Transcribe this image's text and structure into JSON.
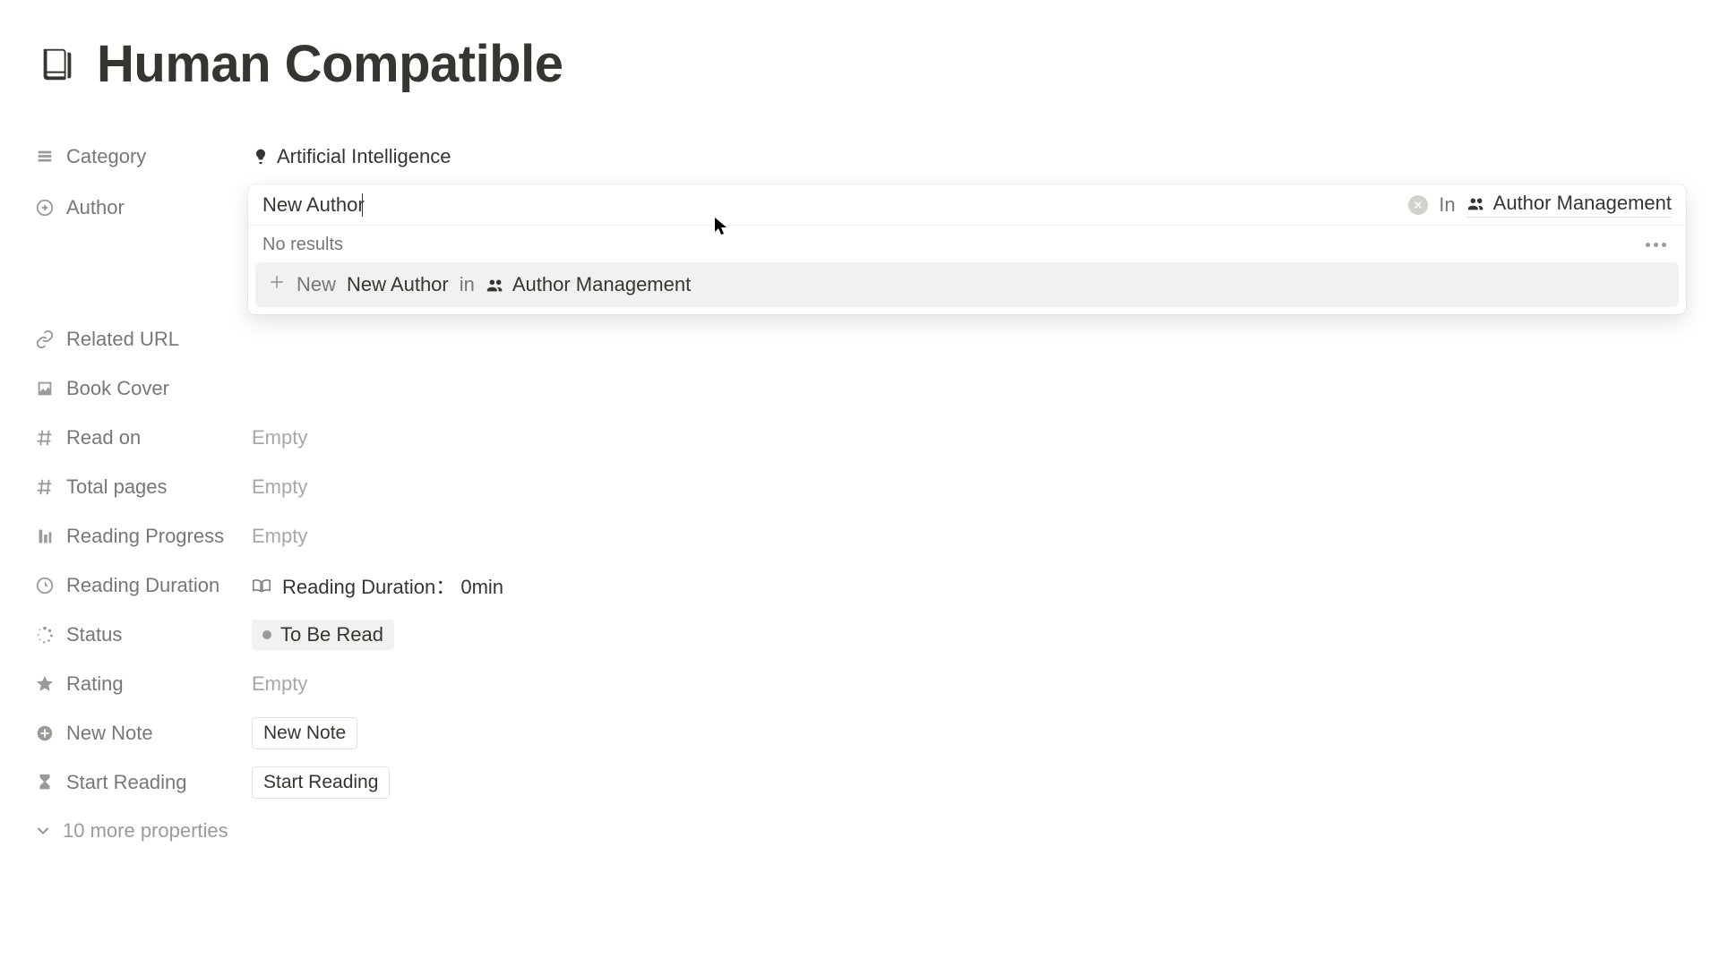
{
  "page": {
    "title": "Human Compatible"
  },
  "properties": {
    "category": {
      "label": "Category",
      "value": "Artificial Intelligence"
    },
    "author": {
      "label": "Author"
    },
    "relatedUrl": {
      "label": "Related URL",
      "value": ""
    },
    "bookCover": {
      "label": "Book Cover",
      "value": ""
    },
    "readOn": {
      "label": "Read on",
      "value": "Empty"
    },
    "totalPages": {
      "label": "Total pages",
      "value": "Empty"
    },
    "readingProgress": {
      "label": "Reading Progress",
      "value": "Empty"
    },
    "readingDuration": {
      "label": "Reading Duration",
      "prefix": "Reading Duration：",
      "value": "0min"
    },
    "status": {
      "label": "Status",
      "value": "To Be Read"
    },
    "rating": {
      "label": "Rating",
      "value": "Empty"
    },
    "newNote": {
      "label": "New Note",
      "button": "New Note"
    },
    "startReading": {
      "label": "Start Reading",
      "button": "Start Reading"
    }
  },
  "relationPopover": {
    "inputValue": "New Author",
    "inLabel": "In",
    "targetDb": "Author Management",
    "noResults": "No results",
    "createPrefix": "New",
    "createValue": "New Author",
    "createIn": "in",
    "createTarget": "Author Management"
  },
  "moreProperties": "10 more properties"
}
